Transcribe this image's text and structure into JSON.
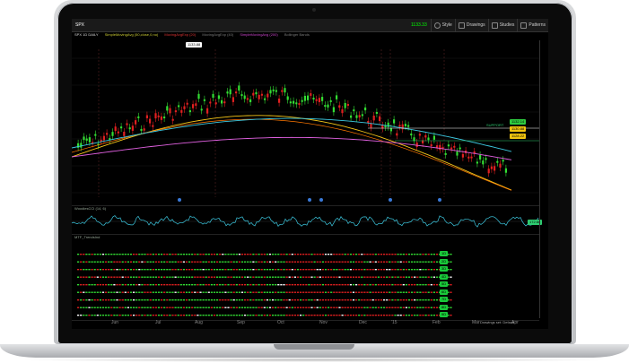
{
  "device": {
    "type": "laptop"
  },
  "toolbar": {
    "symbol": "SPX",
    "price": "1133.33",
    "buttons": [
      {
        "label": "Style",
        "icon": "style-icon"
      },
      {
        "label": "Drawings",
        "icon": "pencil-icon"
      },
      {
        "label": "Studies",
        "icon": "flask-icon"
      },
      {
        "label": "Patterns",
        "icon": "patterns-icon"
      }
    ]
  },
  "legend": {
    "title": "SPX 1D DAILY",
    "items": [
      "SimpleMovingAvg (50,close,0,no)",
      "MovingAvgExp (20)",
      "MovingAvgExp (40)",
      "SimpleMovingAvg (200)",
      "Bollinger Bands"
    ]
  },
  "price_tag": {
    "label": "1133.88",
    "color": "#ffffff"
  },
  "right_labels": [
    {
      "text": "1132.14",
      "color": "#2ecc40"
    },
    {
      "text": "1130.88",
      "color": "#f1c40f"
    },
    {
      "text": "1128.22",
      "color": "#f1c40f"
    },
    {
      "text": "SUPPORT",
      "color": "#2ecc71"
    }
  ],
  "oscillator": {
    "title": "WoodiesCCI (14, 6)",
    "badge": "172.66",
    "badge_color": "#2ecc71"
  },
  "mtf": {
    "title": "MTF_TrendsInd",
    "row_badges": [
      "1D",
      "2D",
      "3D",
      "4D",
      "5D",
      "6D",
      "7D",
      "8D",
      "9D"
    ],
    "badge_color": "#19c93a"
  },
  "x_axis": {
    "labels": [
      "Jun",
      "Jul",
      "Aug",
      "Sep",
      "Oct",
      "Nov",
      "Dec",
      "'15",
      "Feb",
      "Mar",
      "Apr"
    ]
  },
  "colors": {
    "bull": "#33dd33",
    "bear": "#e02020",
    "sma50": "#f5c518",
    "ema": "#ff7700",
    "sma200": "#3cc8e0",
    "bb": "#e060e0"
  },
  "status": {
    "text": "Drawings set: Default"
  }
}
